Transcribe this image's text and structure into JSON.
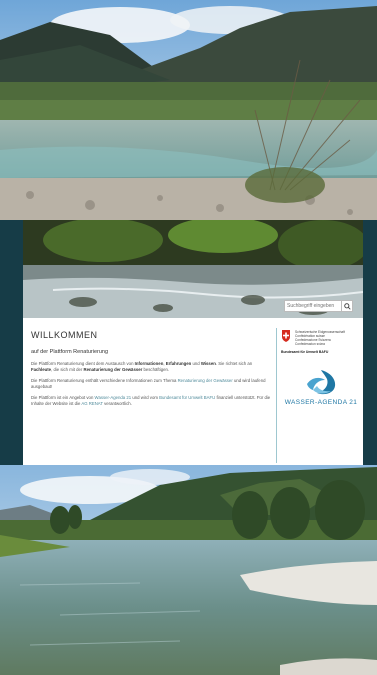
{
  "header": {
    "search_placeholder": "Suchbegriff eingeben"
  },
  "main": {
    "title": "WILLKOMMEN",
    "subtitle": "auf der Plattform Renaturierung",
    "p1": {
      "a": "Die Plattform Renaturierung dient dem Austausch von ",
      "b": "Informationen",
      "c": ", ",
      "d": "Erfahrungen",
      "e": " und ",
      "f": "Wissen",
      "g": ". Sie richtet sich an ",
      "h": "Fachleute",
      "i": ", die sich mit der ",
      "j": "Renaturierung der Gewässer",
      "k": " beschäftigen."
    },
    "p2": {
      "a": "Die Plattform Renaturierung enthält verschiedene Informationen zum Thema ",
      "b": "Renaturierung der Gewässer",
      "c": " und wird laufend ausgebaut!"
    },
    "p3": {
      "a": "Die Plattform ist ein Angebot von ",
      "b": "Wasser-Agenda 21",
      "c": " und wird vom ",
      "d": "Bundesamt für Umwelt BAFU",
      "e": " finanziell unterstützt. Für die Inhalte der Website ist die ",
      "f": "AG RENAT",
      "g": " verantwortlich."
    }
  },
  "sidebar": {
    "confederation": [
      "Schweizerische Eidgenossenschaft",
      "Confédération suisse",
      "Confederazione Svizzera",
      "Confederaziun svizra"
    ],
    "office": "Bundesamt für Umwelt BAFU",
    "agenda_name": "WASSER-AGENDA 21"
  },
  "colors": {
    "band": "#163c47",
    "link": "#4f8a9a",
    "agenda_blue": "#1f77a4",
    "swiss_red": "#d52b1e"
  },
  "icons": [
    "search-icon",
    "swiss-cross-icon",
    "water-drop-logo-icon"
  ]
}
